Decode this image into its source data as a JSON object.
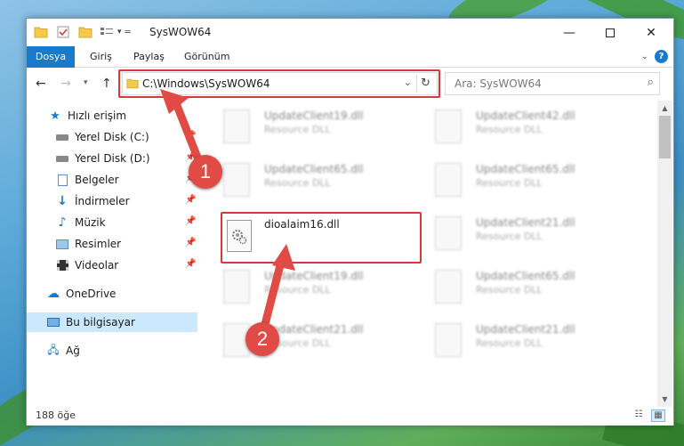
{
  "window": {
    "title": "SysWOW64"
  },
  "ribbon": {
    "tabs": [
      "Dosya",
      "Giriş",
      "Paylaş",
      "Görünüm"
    ],
    "help_label": "?"
  },
  "nav": {
    "address": "C:\\Windows\\SysWOW64",
    "search_placeholder": "Ara: SysWOW64"
  },
  "sidebar": {
    "items": [
      {
        "label": "Hızlı erişim",
        "icon": "star-icon"
      },
      {
        "label": "Yerel Disk (C:)",
        "icon": "drive-icon",
        "pinned": true
      },
      {
        "label": "Yerel Disk (D:)",
        "icon": "drive-icon",
        "pinned": true
      },
      {
        "label": "Belgeler",
        "icon": "documents-icon",
        "pinned": true
      },
      {
        "label": "İndirmeler",
        "icon": "download-icon",
        "pinned": true
      },
      {
        "label": "Müzik",
        "icon": "music-icon",
        "pinned": true
      },
      {
        "label": "Resimler",
        "icon": "pictures-icon",
        "pinned": true
      },
      {
        "label": "Videolar",
        "icon": "video-icon",
        "pinned": true
      },
      {
        "label": "OneDrive",
        "icon": "cloud-icon"
      },
      {
        "label": "Bu bilgisayar",
        "icon": "computer-icon",
        "selected": true
      },
      {
        "label": "Ağ",
        "icon": "network-icon"
      }
    ]
  },
  "files": {
    "left": [
      {
        "name": "UpdateClient19.dll",
        "desc": "Resource DLL"
      },
      {
        "name": "UpdateClient65.dll",
        "desc": "Resource DLL"
      },
      {
        "name": "dioalaim16.dll",
        "desc": ""
      },
      {
        "name": "UpdateClient19.dll",
        "desc": "Resource DLL"
      },
      {
        "name": "UpdateClient21.dll",
        "desc": "Resource DLL"
      }
    ],
    "right": [
      {
        "name": "UpdateClient42.dll",
        "desc": "Resource DLL"
      },
      {
        "name": "UpdateClient65.dll",
        "desc": "Resource DLL"
      },
      {
        "name": "UpdateClient21.dll",
        "desc": "Resource DLL"
      },
      {
        "name": "UpdateClient65.dll",
        "desc": "Resource DLL"
      },
      {
        "name": "UpdateClient21.dll",
        "desc": "Resource DLL"
      }
    ]
  },
  "status": {
    "count": "188 öğe"
  },
  "callouts": [
    "1",
    "2"
  ],
  "colors": {
    "accent": "#1979ca",
    "highlight": "#d53a3a",
    "callout": "#e04b45",
    "selected": "#cce8ff"
  }
}
